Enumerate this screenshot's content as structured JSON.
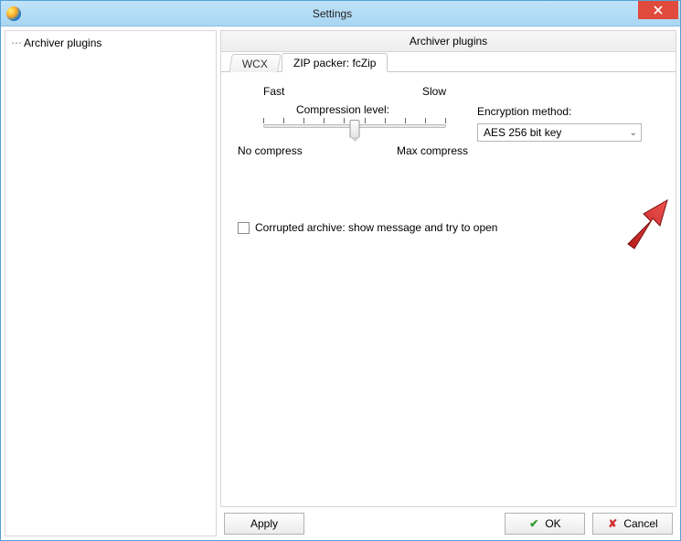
{
  "window": {
    "title": "Settings"
  },
  "sidebar": {
    "items": [
      {
        "label": "Archiver plugins"
      }
    ]
  },
  "panel": {
    "heading": "Archiver plugins",
    "tabs": [
      {
        "label": "WCX"
      },
      {
        "label": "ZIP packer: fcZip"
      }
    ],
    "activeTab": 1
  },
  "compression": {
    "fastLabel": "Fast",
    "slowLabel": "Slow",
    "title": "Compression level:",
    "noCompressLabel": "No compress",
    "maxCompressLabel": "Max compress"
  },
  "encryption": {
    "label": "Encryption method:",
    "selected": "AES 256 bit key"
  },
  "corruptedCheckbox": {
    "label": "Corrupted archive: show message and try to open"
  },
  "buttons": {
    "apply": "Apply",
    "ok": "OK",
    "cancel": "Cancel"
  }
}
